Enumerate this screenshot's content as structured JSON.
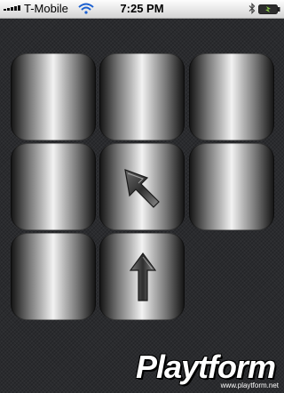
{
  "status_bar": {
    "carrier": "T-Mobile",
    "time": "7:25 PM",
    "icons": [
      "signal-icon",
      "wifi-icon",
      "bluetooth-icon",
      "battery-charging-icon"
    ]
  },
  "board": {
    "rows": 3,
    "cols": 3,
    "tiles": [
      {
        "row": 1,
        "col": 1,
        "icon": null
      },
      {
        "row": 1,
        "col": 2,
        "icon": null
      },
      {
        "row": 1,
        "col": 3,
        "icon": null
      },
      {
        "row": 2,
        "col": 1,
        "icon": null
      },
      {
        "row": 2,
        "col": 2,
        "icon": "arrow-up-left-icon"
      },
      {
        "row": 2,
        "col": 3,
        "icon": null
      },
      {
        "row": 3,
        "col": 1,
        "icon": null
      },
      {
        "row": 3,
        "col": 2,
        "icon": "arrow-up-icon"
      },
      {
        "row": 3,
        "col": 3,
        "icon": "empty-slot"
      }
    ]
  },
  "watermark": {
    "logo": "Playtform",
    "url": "www.playtform.net"
  }
}
